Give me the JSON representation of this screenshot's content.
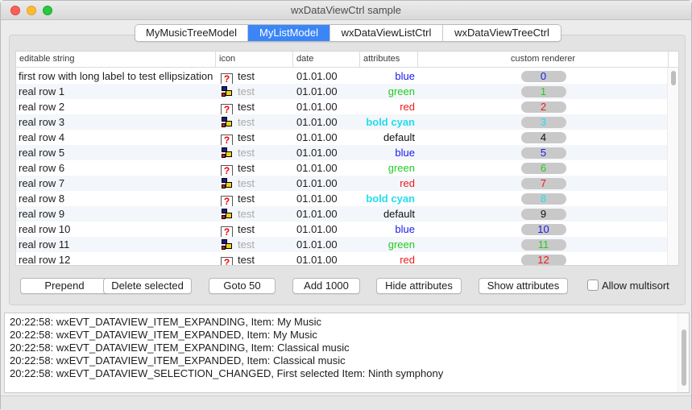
{
  "window": {
    "title": "wxDataViewCtrl sample"
  },
  "tabs": [
    {
      "label": "MyMusicTreeModel",
      "active": false
    },
    {
      "label": "MyListModel",
      "active": true
    },
    {
      "label": "wxDataViewListCtrl",
      "active": false
    },
    {
      "label": "wxDataViewTreeCtrl",
      "active": false
    }
  ],
  "columns": {
    "string": "editable string",
    "icon": "icon",
    "date": "date",
    "attributes": "attributes",
    "custom": "custom renderer"
  },
  "colors": {
    "blue": "#1a1aee",
    "green": "#22cc22",
    "red": "#ee1a1a",
    "cyan": "#22ddee",
    "default": "#111111",
    "accent": "#3b86f7"
  },
  "rows": [
    {
      "string": "first row with long label to test ellipsization",
      "icon": "question-icon",
      "icon_text": "test",
      "icon_text_gray": false,
      "date": "01.01.00",
      "attr": "blue",
      "attr_color": "blue",
      "attr_bold": false,
      "custom": "0"
    },
    {
      "string": "real row 1",
      "icon": "network-icon",
      "icon_text": "test",
      "icon_text_gray": true,
      "date": "01.01.00",
      "attr": "green",
      "attr_color": "green",
      "attr_bold": false,
      "custom": "1"
    },
    {
      "string": "real row 2",
      "icon": "question-icon",
      "icon_text": "test",
      "icon_text_gray": false,
      "date": "01.01.00",
      "attr": "red",
      "attr_color": "red",
      "attr_bold": false,
      "custom": "2"
    },
    {
      "string": "real row 3",
      "icon": "network-icon",
      "icon_text": "test",
      "icon_text_gray": true,
      "date": "01.01.00",
      "attr": "bold cyan",
      "attr_color": "cyan",
      "attr_bold": true,
      "custom": "3"
    },
    {
      "string": "real row 4",
      "icon": "question-icon",
      "icon_text": "test",
      "icon_text_gray": false,
      "date": "01.01.00",
      "attr": "default",
      "attr_color": "default",
      "attr_bold": false,
      "custom": "4"
    },
    {
      "string": "real row 5",
      "icon": "network-icon",
      "icon_text": "test",
      "icon_text_gray": true,
      "date": "01.01.00",
      "attr": "blue",
      "attr_color": "blue",
      "attr_bold": false,
      "custom": "5"
    },
    {
      "string": "real row 6",
      "icon": "question-icon",
      "icon_text": "test",
      "icon_text_gray": false,
      "date": "01.01.00",
      "attr": "green",
      "attr_color": "green",
      "attr_bold": false,
      "custom": "6"
    },
    {
      "string": "real row 7",
      "icon": "network-icon",
      "icon_text": "test",
      "icon_text_gray": true,
      "date": "01.01.00",
      "attr": "red",
      "attr_color": "red",
      "attr_bold": false,
      "custom": "7"
    },
    {
      "string": "real row 8",
      "icon": "question-icon",
      "icon_text": "test",
      "icon_text_gray": false,
      "date": "01.01.00",
      "attr": "bold cyan",
      "attr_color": "cyan",
      "attr_bold": true,
      "custom": "8"
    },
    {
      "string": "real row 9",
      "icon": "network-icon",
      "icon_text": "test",
      "icon_text_gray": true,
      "date": "01.01.00",
      "attr": "default",
      "attr_color": "default",
      "attr_bold": false,
      "custom": "9"
    },
    {
      "string": "real row 10",
      "icon": "question-icon",
      "icon_text": "test",
      "icon_text_gray": false,
      "date": "01.01.00",
      "attr": "blue",
      "attr_color": "blue",
      "attr_bold": false,
      "custom": "10"
    },
    {
      "string": "real row 11",
      "icon": "network-icon",
      "icon_text": "test",
      "icon_text_gray": true,
      "date": "01.01.00",
      "attr": "green",
      "attr_color": "green",
      "attr_bold": false,
      "custom": "11"
    },
    {
      "string": "real row 12",
      "icon": "question-icon",
      "icon_text": "test",
      "icon_text_gray": false,
      "date": "01.01.00",
      "attr": "red",
      "attr_color": "red",
      "attr_bold": false,
      "custom": "12"
    }
  ],
  "buttons": {
    "prepend": "Prepend",
    "delete_selected": "Delete selected",
    "goto50": "Goto 50",
    "add1000": "Add 1000",
    "hide_attributes": "Hide attributes",
    "show_attributes": "Show attributes"
  },
  "multisort": {
    "label": "Allow multisort",
    "checked": false
  },
  "log": [
    "20:22:58: wxEVT_DATAVIEW_ITEM_EXPANDING, Item: My Music",
    "20:22:58: wxEVT_DATAVIEW_ITEM_EXPANDED, Item: My Music",
    "20:22:58: wxEVT_DATAVIEW_ITEM_EXPANDING, Item: Classical music",
    "20:22:58: wxEVT_DATAVIEW_ITEM_EXPANDED, Item: Classical music",
    "20:22:58: wxEVT_DATAVIEW_SELECTION_CHANGED, First selected Item: Ninth symphony"
  ]
}
